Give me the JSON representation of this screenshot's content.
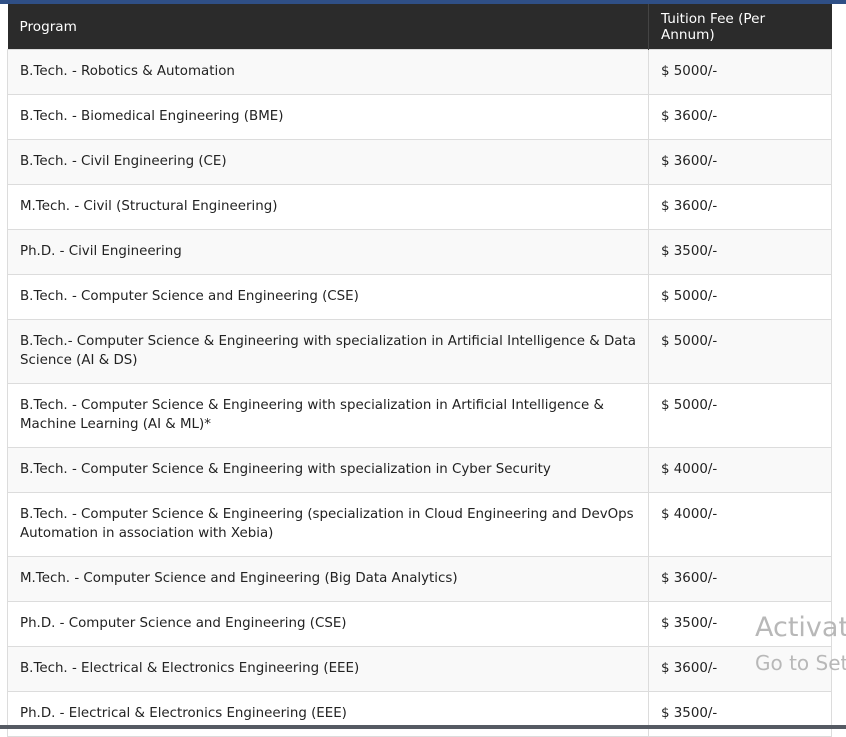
{
  "table": {
    "headers": {
      "program": "Program",
      "fee": "Tuition Fee (Per Annum)"
    },
    "rows": [
      {
        "program": "B.Tech. - Robotics & Automation",
        "fee": "$ 5000/-"
      },
      {
        "program": "B.Tech. - Biomedical Engineering (BME)",
        "fee": "$ 3600/-"
      },
      {
        "program": "B.Tech. - Civil Engineering (CE)",
        "fee": "$ 3600/-"
      },
      {
        "program": "M.Tech. - Civil (Structural Engineering)",
        "fee": "$ 3600/-"
      },
      {
        "program": "Ph.D. - Civil Engineering",
        "fee": "$ 3500/-"
      },
      {
        "program": "B.Tech. - Computer Science and Engineering (CSE)",
        "fee": "$ 5000/-"
      },
      {
        "program": "B.Tech.- Computer Science & Engineering with specialization in Artificial Intelligence & Data Science (AI & DS)",
        "fee": "$ 5000/-"
      },
      {
        "program": "B.Tech. - Computer Science & Engineering with specialization in Artificial Intelligence & Machine Learning (AI & ML)*",
        "fee": "$ 5000/-"
      },
      {
        "program": "B.Tech. - Computer Science & Engineering with specialization in Cyber Security",
        "fee": "$ 4000/-"
      },
      {
        "program": "B.Tech. - Computer Science & Engineering (specialization in Cloud Engineering and DevOps Automation in association with Xebia)",
        "fee": "$ 4000/-"
      },
      {
        "program": "M.Tech. - Computer Science and Engineering (Big Data Analytics)",
        "fee": "$ 3600/-"
      },
      {
        "program": "Ph.D. - Computer Science and Engineering (CSE)",
        "fee": "$ 3500/-"
      },
      {
        "program": "B.Tech. - Electrical & Electronics Engineering (EEE)",
        "fee": "$ 3600/-"
      },
      {
        "program": "Ph.D. - Electrical & Electronics Engineering (EEE)",
        "fee": "$ 3500/-"
      }
    ]
  },
  "watermark": {
    "line1": "Activate",
    "line2": "Go to Set"
  }
}
